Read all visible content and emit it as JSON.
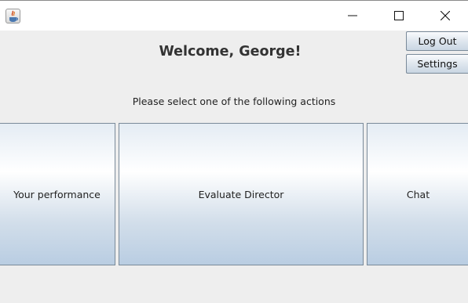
{
  "window": {
    "controls": [
      "minimize-icon",
      "maximize-icon",
      "close-icon"
    ]
  },
  "header": {
    "welcome": "Welcome, George!",
    "logout_label": "Log Out",
    "settings_label": "Settings"
  },
  "main": {
    "prompt": "Please select one of the following actions",
    "actions": [
      {
        "label": "Your performance"
      },
      {
        "label": "Evaluate Director"
      },
      {
        "label": "Chat"
      }
    ]
  },
  "colors": {
    "background": "#eeeeee",
    "button_gradient_top": "#ffffff",
    "button_gradient_bottom": "#b9cde2",
    "button_border": "#7a8a99"
  }
}
